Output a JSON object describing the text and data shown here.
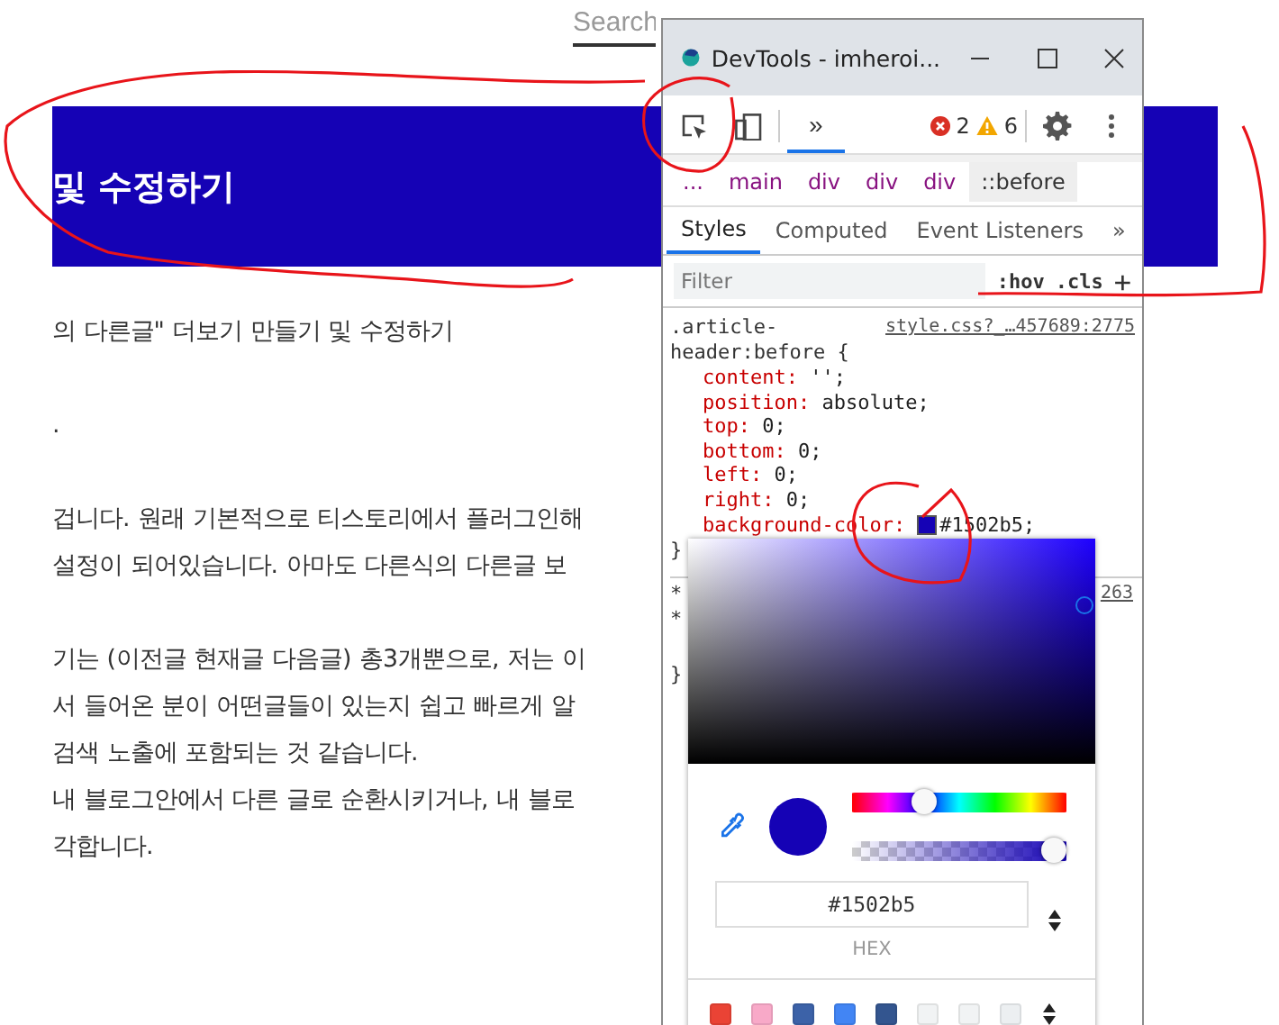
{
  "blog": {
    "search": {
      "placeholder": "Search"
    },
    "banner": {
      "title": "및 수정하기"
    },
    "paragraphs": [
      [
        "의 다른글\" 더보기 만들기 및 수정하기"
      ],
      [
        "."
      ],
      [
        "겁니다. 원래 기본적으로 티스토리에서 플러그인해",
        "설정이 되어있습니다. 아마도 다른식의 다른글 보"
      ],
      [
        "기는 (이전글 현재글 다음글) 총3개뿐으로, 저는 이",
        "서 들어온 분이 어떤글들이 있는지 쉽고 빠르게 알",
        "검색 노출에 포함되는 것 같습니다.",
        "내 블로그안에서 다른 글로 순환시키거나, 내 블로",
        "각합니다."
      ]
    ]
  },
  "devtools": {
    "title": "DevTools - imheroi...",
    "toolbar": {
      "tabs": [
        {
          "label": "»",
          "selected": true
        }
      ],
      "errors": "2",
      "warnings": "6"
    },
    "breadcrumbs": [
      {
        "label": "...",
        "selected": false
      },
      {
        "label": "main",
        "selected": false
      },
      {
        "label": "div",
        "selected": false
      },
      {
        "label": "div",
        "selected": false
      },
      {
        "label": "div",
        "selected": false
      },
      {
        "label": "::before",
        "selected": true
      }
    ],
    "panel_tabs": [
      {
        "label": "Styles",
        "selected": true
      },
      {
        "label": "Computed",
        "selected": false
      },
      {
        "label": "Event Listeners",
        "selected": false
      },
      {
        "label": "»",
        "selected": false
      }
    ],
    "filter": {
      "placeholder": "Filter",
      "hov": ":hov",
      "cls": ".cls",
      "add": "+"
    },
    "rule": {
      "selector": ".article-header:before {",
      "source": "style.css?_…457689:2775",
      "close": "}",
      "declarations": [
        {
          "property": "content:",
          "value": "'';",
          "kind": "plain"
        },
        {
          "property": "position:",
          "value": "absolute;",
          "kind": "plain"
        },
        {
          "property": "top:",
          "value": "0;",
          "kind": "plain"
        },
        {
          "property": "bottom:",
          "value": "0;",
          "kind": "plain"
        },
        {
          "property": "left:",
          "value": "0;",
          "kind": "plain"
        },
        {
          "property": "right:",
          "value": "0;",
          "kind": "plain"
        },
        {
          "property": "background-color:",
          "value": "#1502b5;",
          "kind": "color"
        }
      ]
    },
    "next_rule": {
      "lines": [
        "*",
        "*"
      ],
      "source": "263",
      "close": "}"
    },
    "color_picker": {
      "color": "#1502b5",
      "hue": {
        "level": 0.31
      },
      "alpha": {
        "level": 1
      },
      "hex": "#1502b5",
      "format": "HEX",
      "palette": [
        {
          "color": "#ea4335"
        },
        {
          "color": "#f8a9c8"
        },
        {
          "color": "#3c62a8"
        },
        {
          "color": "#4285f4"
        },
        {
          "color": "#33558f"
        },
        {
          "color": "#f1f3f4"
        },
        {
          "color": "#f1f3f4"
        },
        {
          "color": "#eceff1"
        }
      ]
    }
  }
}
